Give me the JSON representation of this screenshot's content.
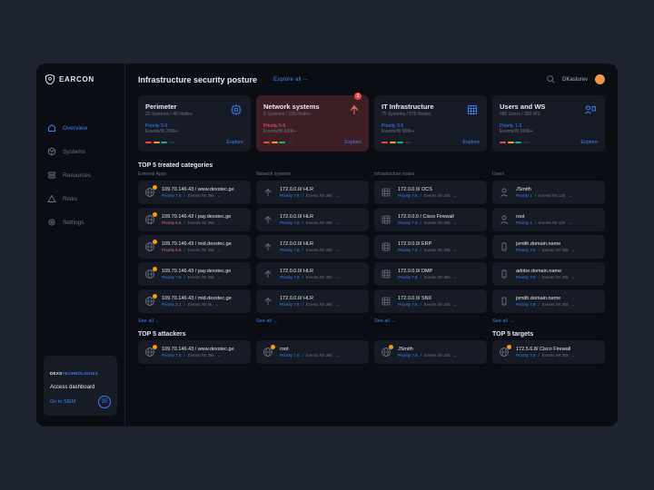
{
  "brand": "EARCON",
  "nav": {
    "items": [
      {
        "label": "Overview",
        "icon": "home",
        "active": true
      },
      {
        "label": "Systems",
        "icon": "cube"
      },
      {
        "label": "Resources",
        "icon": "layers"
      },
      {
        "label": "Risks",
        "icon": "warning"
      },
      {
        "label": "Settings",
        "icon": "gear"
      }
    ]
  },
  "bottom": {
    "tag_a": "DEXS",
    "tag_b": "TECHNOLOGIES",
    "title": "Access dashboard",
    "link": "Go to SIEM",
    "count": "35"
  },
  "header": {
    "title": "Infrastructure security posture",
    "explore": "Explore all →",
    "username": "DKasturev"
  },
  "cards": [
    {
      "title": "Perimeter",
      "sub": "20 Systems / 40 Nodes",
      "priority": "Priority 5-9",
      "events": "Events/W 200k+",
      "explore": "Explore",
      "alert": false,
      "pclass": "p-blue"
    },
    {
      "title": "Network systems",
      "sub": "9 Systems / 100 Nodes",
      "priority": "Priority 5-9",
      "events": "Events/W 600k+",
      "explore": "Explore",
      "alert": true,
      "badge": "1",
      "pclass": "p-red"
    },
    {
      "title": "IT Infrastructure",
      "sub": "75 Systems / 575 Nodes",
      "priority": "Priority 3-5",
      "events": "Events/W 900k+",
      "explore": "Explore",
      "alert": false,
      "pclass": "p-blue"
    },
    {
      "title": "Users and WS",
      "sub": "680 Users / 350 WS",
      "priority": "Priority 1-3",
      "events": "Events/W 900k+",
      "explore": "Explore",
      "alert": false,
      "pclass": "p-blue"
    }
  ],
  "section1": {
    "title": "TOP 5 treated categories",
    "columns": [
      {
        "header": "External Apps",
        "see": "See all →",
        "items": [
          {
            "title": "109.70.146.43 / www.dexstec.ge",
            "pr": "Priority 7.8",
            "ev": "Events /W 35k",
            "alert": true
          },
          {
            "title": "109.70.146.43 / pay.dexstec.ge",
            "pr": "Priority 5.5",
            "ev": "Events /W 35k",
            "alert": true,
            "red": true
          },
          {
            "title": "109.70.146.43 / mid.dexstec.ge",
            "pr": "Priority 5.5",
            "ev": "Events /W 35k",
            "alert": true,
            "red": true
          },
          {
            "title": "109.70.146.43 / pay.dexstec.ge",
            "pr": "Priority 7.8",
            "ev": "Events /W 35k",
            "alert": true
          },
          {
            "title": "109.70.146.43 / mid.dexstec.ge",
            "pr": "Priority 3.1",
            "ev": "Events /W 5k",
            "alert": true
          }
        ]
      },
      {
        "header": "Network systems",
        "see": "See all →",
        "items": [
          {
            "title": "172.0.0.0/ HLR",
            "pr": "Priority 7.8",
            "ev": "Events /W 35k"
          },
          {
            "title": "172.0.0.0/ HLR",
            "pr": "Priority 7.8",
            "ev": "Events /W 35k"
          },
          {
            "title": "172.0.0.0/ HLR",
            "pr": "Priority 7.8",
            "ev": "Events /W 35k"
          },
          {
            "title": "172.0.0.0/ HLR",
            "pr": "Priority 7.8",
            "ev": "Events /W 35k"
          },
          {
            "title": "172.0.0.0/ HLR",
            "pr": "Priority 7.8",
            "ev": "Events /W 35k"
          }
        ]
      },
      {
        "header": "Infrastructure nodes",
        "see": "See all →",
        "items": [
          {
            "title": "172.0.0.0/ OCS",
            "pr": "Priority 7.8",
            "ev": "Events /W 35k"
          },
          {
            "title": "172.0.0.0 / Cisco Firewall",
            "pr": "Priority 7.8",
            "ev": "Events /W 35k"
          },
          {
            "title": "172.0.0.0/ ERP",
            "pr": "Priority 7.8",
            "ev": "Events /W 35k"
          },
          {
            "title": "172.0.0.0/ DMP",
            "pr": "Priority 7.8",
            "ev": "Events /W 35k"
          },
          {
            "title": "172.0.0.0/ SNX",
            "pr": "Priority 7.8",
            "ev": "Events /W 35k"
          }
        ]
      },
      {
        "header": "Users",
        "see": "See all →",
        "items": [
          {
            "title": "JSmith",
            "pr": "Priority 1",
            "ev": "Events /W 130",
            "icon": "user"
          },
          {
            "title": "root",
            "pr": "Priority 1",
            "ev": "Events /W 100",
            "icon": "user"
          },
          {
            "title": "jsmith.domain.name",
            "pr": "Priority 7.8",
            "ev": "Events /W 35k",
            "icon": "ws"
          },
          {
            "title": "adobe.domain.name",
            "pr": "Priority 7.8",
            "ev": "Events /W 35k",
            "icon": "ws"
          },
          {
            "title": "jsmith.domain.name",
            "pr": "Priority 7.8",
            "ev": "Events /W 35k",
            "icon": "ws"
          }
        ]
      }
    ]
  },
  "section2": {
    "left_title": "TOP 5 attackers",
    "right_title": "TOP 5 targets",
    "attackers": [
      {
        "title": "109.70.146.43 / www.dexstec.ge",
        "pr": "Priority 7.8",
        "ev": "Events /W 35k"
      },
      {
        "title": "root",
        "pr": "Priority 7.8",
        "ev": "Events /W 35k"
      },
      {
        "title": "JSmith",
        "pr": "Priority 7.8",
        "ev": "Events /W 35k"
      }
    ],
    "targets": [
      {
        "title": "172.5.6.8/ Cisco Firewall",
        "pr": "Priority 7.8",
        "ev": "Events /W 35k"
      }
    ]
  }
}
